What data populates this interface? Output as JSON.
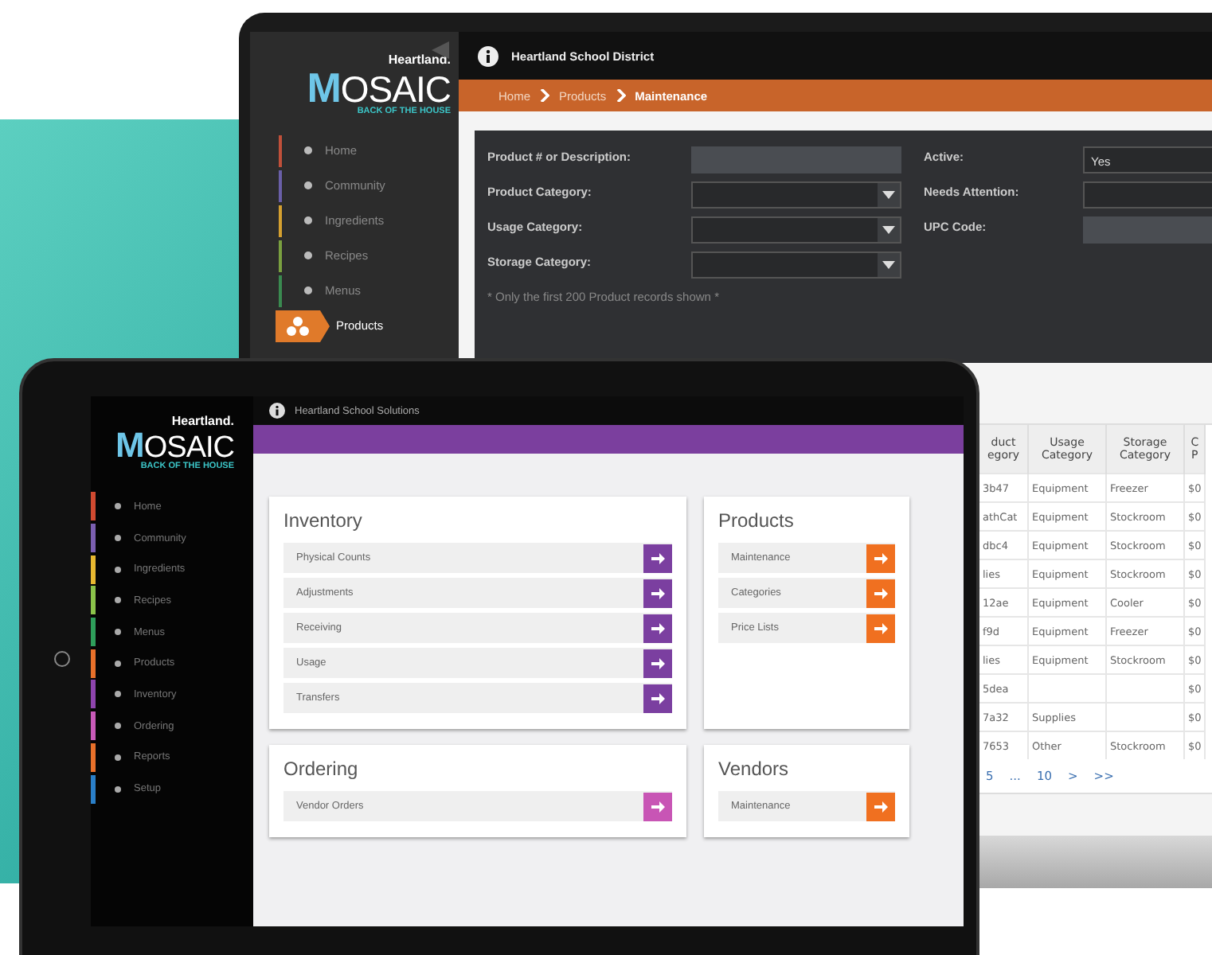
{
  "laptop": {
    "logo": {
      "brand": "Heartland.",
      "name": "MOSAIC",
      "tagline": "BACK OF THE HOUSE"
    },
    "sidebar": {
      "items": [
        {
          "label": "Home",
          "color": "#c0503a",
          "selected": false
        },
        {
          "label": "Community",
          "color": "#6a5fa8",
          "selected": false
        },
        {
          "label": "Ingredients",
          "color": "#d4a030",
          "selected": false
        },
        {
          "label": "Recipes",
          "color": "#7aa040",
          "selected": false
        },
        {
          "label": "Menus",
          "color": "#3a8a50",
          "selected": false
        },
        {
          "label": "Products",
          "color": "#e07a2a",
          "selected": true
        }
      ]
    },
    "header": {
      "title": "Heartland School District"
    },
    "breadcrumb": [
      {
        "label": "Home",
        "current": false
      },
      {
        "label": "Products",
        "current": false
      },
      {
        "label": "Maintenance",
        "current": true
      }
    ],
    "filters_left": [
      {
        "label": "Product # or Description:",
        "kind": "input"
      },
      {
        "label": "Product Category:",
        "kind": "select"
      },
      {
        "label": "Usage Category:",
        "kind": "select"
      },
      {
        "label": "Storage Category:",
        "kind": "select"
      }
    ],
    "filters_right": [
      {
        "label": "Active:",
        "kind": "box",
        "value": "Yes"
      },
      {
        "label": "Needs Attention:",
        "kind": "box"
      },
      {
        "label": "UPC Code:",
        "kind": "input"
      }
    ],
    "note": "* Only the first 200 Product records shown *",
    "table": {
      "columns": [
        "duct\negory",
        "Usage\nCategory",
        "Storage\nCategory",
        "C\nP"
      ],
      "rows": [
        [
          "3b47",
          "Equipment",
          "Freezer",
          "$0"
        ],
        [
          "athCat",
          "Equipment",
          "Stockroom",
          "$0"
        ],
        [
          "dbc4",
          "Equipment",
          "Stockroom",
          "$0"
        ],
        [
          "lies",
          "Equipment",
          "Stockroom",
          "$0"
        ],
        [
          "12ae",
          "Equipment",
          "Cooler",
          "$0"
        ],
        [
          "f9d",
          "Equipment",
          "Freezer",
          "$0"
        ],
        [
          "lies",
          "Equipment",
          "Stockroom",
          "$0"
        ],
        [
          "5dea",
          "",
          "",
          "$0"
        ],
        [
          "7a32",
          "Supplies",
          "",
          "$0"
        ],
        [
          "7653",
          "Other",
          "Stockroom",
          "$0"
        ]
      ],
      "pagination": [
        "5",
        "...",
        "10",
        ">",
        ">>"
      ]
    }
  },
  "tablet": {
    "logo": {
      "brand": "Heartland.",
      "name": "MOSAIC",
      "tagline": "BACK OF THE HOUSE"
    },
    "header": {
      "title": "Heartland School Solutions"
    },
    "sidebar": {
      "items": [
        {
          "label": "Home",
          "color": "#d04a30"
        },
        {
          "label": "Community",
          "color": "#7b5fb0"
        },
        {
          "label": "Ingredients",
          "color": "#e8b830"
        },
        {
          "label": "Recipes",
          "color": "#8bc34a"
        },
        {
          "label": "Menus",
          "color": "#2e9e5a"
        },
        {
          "label": "Products",
          "color": "#e8702a"
        },
        {
          "label": "Inventory",
          "color": "#8e44ad"
        },
        {
          "label": "Ordering",
          "color": "#c85ab8"
        },
        {
          "label": "Reports",
          "color": "#e8702a"
        },
        {
          "label": "Setup",
          "color": "#2a7fc8"
        }
      ]
    },
    "cards": [
      {
        "title": "Inventory",
        "color": "#7b3fa0",
        "items": [
          "Physical Counts",
          "Adjustments",
          "Receiving",
          "Usage",
          "Transfers"
        ]
      },
      {
        "title": "Products",
        "color": "#f07020",
        "items": [
          "Maintenance",
          "Categories",
          "Price Lists"
        ]
      },
      {
        "title": "Ordering",
        "color": "#c855b5",
        "items": [
          "Vendor Orders"
        ]
      },
      {
        "title": "Vendors",
        "color": "#f07020",
        "items": [
          "Maintenance"
        ]
      }
    ]
  }
}
